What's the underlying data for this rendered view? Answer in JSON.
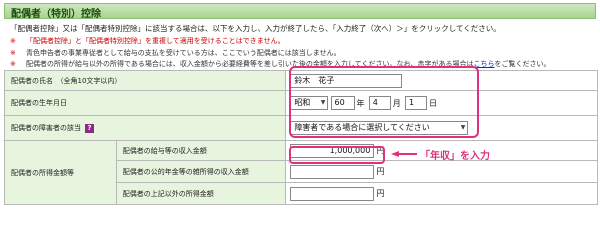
{
  "title": "配偶者（特別）控除",
  "intro": "「配偶者控除」又は「配偶者特別控除」に該当する場合は、以下を入力し、入力が終了したら、「入力終了（次へ）＞」をクリックしてください。",
  "notes": [
    {
      "mark": "※",
      "text": "「配偶者控除」と「配偶者特別控除」を重複して適用を受けることはできません。",
      "red": true
    },
    {
      "mark": "※",
      "text": "青色申告者の事業専従者として給与の支払を受けている方は、ここでいう配偶者には該当しません。",
      "red": false
    },
    {
      "mark": "※",
      "text": "配偶者の所得が給与以外の所得である場合には、収入金額から必要経費等を差し引いた後の金額を入力してください。なお、赤字がある場合は",
      "link": "こちら",
      "after": "をご覧ください。",
      "red": false
    }
  ],
  "form": {
    "name_label": "配偶者の氏名　（全角10文字以内）",
    "name_value": "鈴木　花子",
    "birth_label": "配偶者の生年月日",
    "era_value": "昭和",
    "year_value": "60",
    "year_unit": "年",
    "month_value": "4",
    "month_unit": "月",
    "day_value": "1",
    "day_unit": "日",
    "disability_label": "配偶者の障害者の該当",
    "disability_help": "?",
    "disability_placeholder": "障害者である場合に選択してください",
    "income_label": "配偶者の所得金額等",
    "salary_label": "配偶者の給与等の収入金額",
    "salary_value": "1,000,000",
    "yen": "円",
    "pension_label": "配偶者の公的年金等の雑所得の収入金額",
    "pension_value": "",
    "other_label": "配偶者の上記以外の所得金額",
    "other_value": ""
  },
  "annotation": {
    "text": "「年収」を入力",
    "color": "#e0317f"
  }
}
